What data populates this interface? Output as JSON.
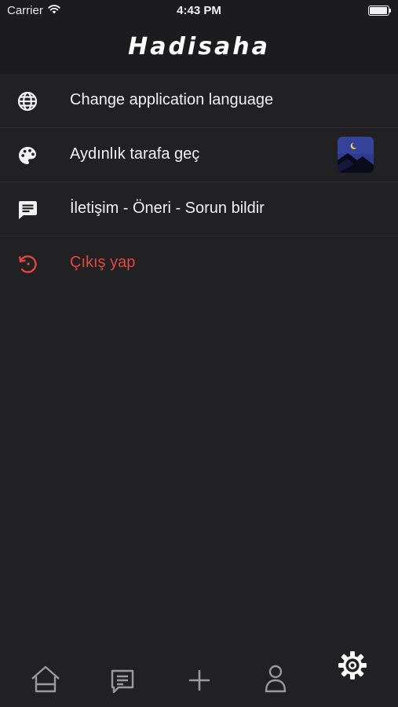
{
  "status_bar": {
    "carrier": "Carrier",
    "time": "4:43 PM",
    "icons": [
      "wifi-icon",
      "battery-icon"
    ]
  },
  "header": {
    "title": "Hadisaha"
  },
  "settings": {
    "items": [
      {
        "label": "Change application language",
        "icon": "globe-icon"
      },
      {
        "label": "Aydınlık tarafa geç",
        "icon": "palette-icon",
        "accessory": "night-theme-thumbnail"
      },
      {
        "label": "İletişim - Öneri - Sorun bildir",
        "icon": "message-icon"
      },
      {
        "label": "Çıkış yap",
        "icon": "logout-icon",
        "color": "#e2473f"
      }
    ]
  },
  "tab_bar": {
    "tabs": [
      {
        "name": "home",
        "icon": "home-icon",
        "active": false
      },
      {
        "name": "messages",
        "icon": "chat-icon",
        "active": false
      },
      {
        "name": "add",
        "icon": "plus-icon",
        "active": false
      },
      {
        "name": "profile",
        "icon": "user-icon",
        "active": false
      },
      {
        "name": "settings",
        "icon": "gear-icon",
        "active": true
      }
    ]
  },
  "colors": {
    "background": "#212124",
    "header": "#1c1c1e",
    "text": "#f2f2f2",
    "danger": "#e2473f",
    "inactive_icon": "#9a9a9c",
    "active_icon": "#ffffff"
  }
}
